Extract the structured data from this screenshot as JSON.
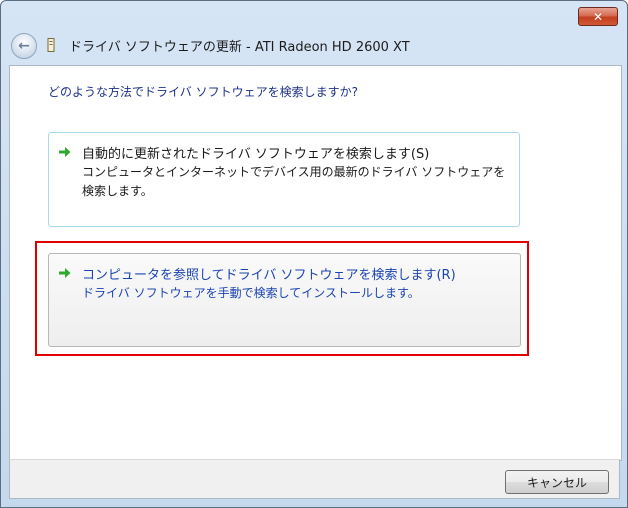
{
  "window": {
    "title": "ドライバ ソフトウェアの更新 - ATI Radeon HD 2600 XT",
    "close_label": "✕"
  },
  "question": "どのような方法でドライバ ソフトウェアを検索しますか?",
  "options": [
    {
      "title": "自動的に更新されたドライバ ソフトウェアを検索します(S)",
      "description": "コンピュータとインターネットでデバイス用の最新のドライバ ソフトウェアを検索します。"
    },
    {
      "title": "コンピュータを参照してドライバ ソフトウェアを検索します(R)",
      "description": "ドライバ ソフトウェアを手動で検索してインストールします。"
    }
  ],
  "footer": {
    "cancel_label": "キャンセル"
  },
  "colors": {
    "arrow": "#2eaa2e",
    "highlight": "#e00000",
    "link": "#1b44b4"
  },
  "icons": {
    "back": "back-arrow-icon",
    "title": "device-icon",
    "option_arrow": "green-arrow-icon",
    "close": "close-icon"
  }
}
